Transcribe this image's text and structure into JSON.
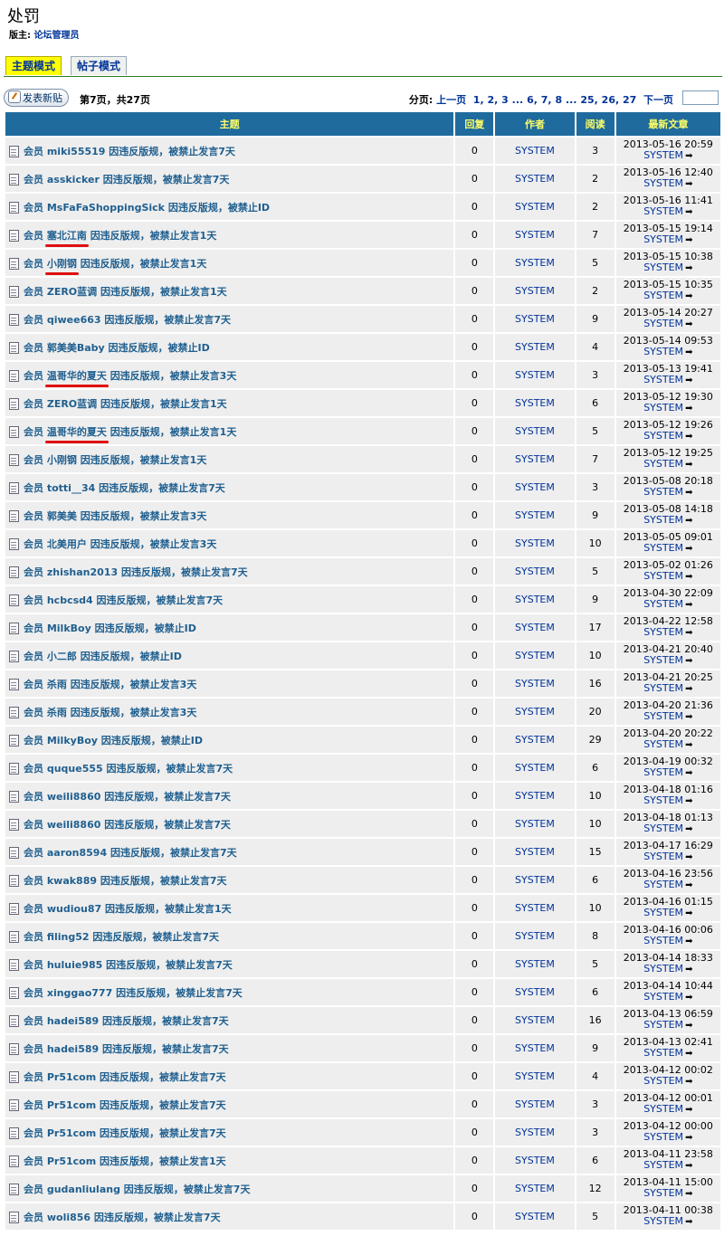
{
  "page": {
    "title": "处罚",
    "moderator_label": "版主:",
    "moderator_name": "论坛管理员"
  },
  "tabs": [
    {
      "label": "主题模式",
      "active": true
    },
    {
      "label": "帖子模式",
      "active": false
    }
  ],
  "toolbar": {
    "new_post_label": "发表新贴",
    "page_info": "第7页，共27页",
    "pager_label": "分页:",
    "prev": "上一页",
    "pages": [
      "1",
      "2",
      "3",
      "...",
      "6",
      "7",
      "8",
      "...",
      "25",
      "26",
      "27"
    ],
    "next": "下一页",
    "jump_value": ""
  },
  "columns": {
    "subject": "主题",
    "replies": "回复",
    "author": "作者",
    "views": "阅读",
    "last_post": "最新文章"
  },
  "colors": {
    "header_bg": "#1f6b9e",
    "header_text": "#ffff66",
    "row_bg": "#eeeeee",
    "link": "#1f5f8f",
    "active_tab": "#ffff00",
    "annotation": "#e01010"
  },
  "rows": [
    {
      "prefix": "会员",
      "member": "miki55519",
      "suffix": "因违反版规，被禁止发言7天",
      "replies": "0",
      "author": "SYSTEM",
      "views": "3",
      "date": "2013-05-16 20:59",
      "last_user": "SYSTEM",
      "marked": false
    },
    {
      "prefix": "会员",
      "member": "asskicker",
      "suffix": "因违反版规，被禁止发言7天",
      "replies": "0",
      "author": "SYSTEM",
      "views": "2",
      "date": "2013-05-16 12:40",
      "last_user": "SYSTEM",
      "marked": false
    },
    {
      "prefix": "会员",
      "member": "MsFaFaShoppingSick",
      "suffix": "因违反版规，被禁止ID",
      "replies": "0",
      "author": "SYSTEM",
      "views": "2",
      "date": "2013-05-16 11:41",
      "last_user": "SYSTEM",
      "marked": false
    },
    {
      "prefix": "会员",
      "member": "塞北江南",
      "suffix": "因违反版规，被禁止发言1天",
      "replies": "0",
      "author": "SYSTEM",
      "views": "7",
      "date": "2013-05-15 19:14",
      "last_user": "SYSTEM",
      "marked": true
    },
    {
      "prefix": "会员",
      "member": "小刚钢",
      "suffix": "因违反版规，被禁止发言1天",
      "replies": "0",
      "author": "SYSTEM",
      "views": "5",
      "date": "2013-05-15 10:38",
      "last_user": "SYSTEM",
      "marked": true
    },
    {
      "prefix": "会员",
      "member": "ZERO蓝调",
      "suffix": "因违反版规，被禁止发言1天",
      "replies": "0",
      "author": "SYSTEM",
      "views": "2",
      "date": "2013-05-15 10:35",
      "last_user": "SYSTEM",
      "marked": false
    },
    {
      "prefix": "会员",
      "member": "qiwee663",
      "suffix": "因违反版规，被禁止发言7天",
      "replies": "0",
      "author": "SYSTEM",
      "views": "9",
      "date": "2013-05-14 20:27",
      "last_user": "SYSTEM",
      "marked": false
    },
    {
      "prefix": "会员",
      "member": "郭美美Baby",
      "suffix": "因违反版规，被禁止ID",
      "replies": "0",
      "author": "SYSTEM",
      "views": "4",
      "date": "2013-05-14 09:53",
      "last_user": "SYSTEM",
      "marked": false
    },
    {
      "prefix": "会员",
      "member": "温哥华的夏天",
      "suffix": "因违反版规，被禁止发言3天",
      "replies": "0",
      "author": "SYSTEM",
      "views": "3",
      "date": "2013-05-13 19:41",
      "last_user": "SYSTEM",
      "marked": true
    },
    {
      "prefix": "会员",
      "member": "ZERO蓝调",
      "suffix": "因违反版规，被禁止发言1天",
      "replies": "0",
      "author": "SYSTEM",
      "views": "6",
      "date": "2013-05-12 19:30",
      "last_user": "SYSTEM",
      "marked": false
    },
    {
      "prefix": "会员",
      "member": "温哥华的夏天",
      "suffix": "因违反版规，被禁止发言1天",
      "replies": "0",
      "author": "SYSTEM",
      "views": "5",
      "date": "2013-05-12 19:26",
      "last_user": "SYSTEM",
      "marked": true
    },
    {
      "prefix": "会员",
      "member": "小刚钢",
      "suffix": "因违反版规，被禁止发言1天",
      "replies": "0",
      "author": "SYSTEM",
      "views": "7",
      "date": "2013-05-12 19:25",
      "last_user": "SYSTEM",
      "marked": false
    },
    {
      "prefix": "会员",
      "member": "totti__34",
      "suffix": "因违反版规，被禁止发言7天",
      "replies": "0",
      "author": "SYSTEM",
      "views": "3",
      "date": "2013-05-08 20:18",
      "last_user": "SYSTEM",
      "marked": false
    },
    {
      "prefix": "会员",
      "member": "郭美美",
      "suffix": "因违反版规，被禁止发言3天",
      "replies": "0",
      "author": "SYSTEM",
      "views": "9",
      "date": "2013-05-08 14:18",
      "last_user": "SYSTEM",
      "marked": false
    },
    {
      "prefix": "会员",
      "member": "北美用户",
      "suffix": "因违反版规，被禁止发言3天",
      "replies": "0",
      "author": "SYSTEM",
      "views": "10",
      "date": "2013-05-05 09:01",
      "last_user": "SYSTEM",
      "marked": false
    },
    {
      "prefix": "会员",
      "member": "zhishan2013",
      "suffix": "因违反版规，被禁止发言7天",
      "replies": "0",
      "author": "SYSTEM",
      "views": "5",
      "date": "2013-05-02 01:26",
      "last_user": "SYSTEM",
      "marked": false
    },
    {
      "prefix": "会员",
      "member": "hcbcsd4",
      "suffix": "因违反版规，被禁止发言7天",
      "replies": "0",
      "author": "SYSTEM",
      "views": "9",
      "date": "2013-04-30 22:09",
      "last_user": "SYSTEM",
      "marked": false
    },
    {
      "prefix": "会员",
      "member": "MilkBoy",
      "suffix": "因违反版规，被禁止ID",
      "replies": "0",
      "author": "SYSTEM",
      "views": "17",
      "date": "2013-04-22 12:58",
      "last_user": "SYSTEM",
      "marked": false
    },
    {
      "prefix": "会员",
      "member": "小二郎",
      "suffix": "因违反版规，被禁止ID",
      "replies": "0",
      "author": "SYSTEM",
      "views": "10",
      "date": "2013-04-21 20:40",
      "last_user": "SYSTEM",
      "marked": false
    },
    {
      "prefix": "会员",
      "member": "杀雨",
      "suffix": "因违反版规，被禁止发言3天",
      "replies": "0",
      "author": "SYSTEM",
      "views": "16",
      "date": "2013-04-21 20:25",
      "last_user": "SYSTEM",
      "marked": false
    },
    {
      "prefix": "会员",
      "member": "杀雨",
      "suffix": "因违反版规，被禁止发言3天",
      "replies": "0",
      "author": "SYSTEM",
      "views": "20",
      "date": "2013-04-20 21:36",
      "last_user": "SYSTEM",
      "marked": false
    },
    {
      "prefix": "会员",
      "member": "MilkyBoy",
      "suffix": "因违反版规，被禁止ID",
      "replies": "0",
      "author": "SYSTEM",
      "views": "29",
      "date": "2013-04-20 20:22",
      "last_user": "SYSTEM",
      "marked": false
    },
    {
      "prefix": "会员",
      "member": "ququе555",
      "suffix": "因违反版规，被禁止发言7天",
      "replies": "0",
      "author": "SYSTEM",
      "views": "6",
      "date": "2013-04-19 00:32",
      "last_user": "SYSTEM",
      "marked": false
    },
    {
      "prefix": "会员",
      "member": "weili8860",
      "suffix": "因违反版规，被禁止发言7天",
      "replies": "0",
      "author": "SYSTEM",
      "views": "10",
      "date": "2013-04-18 01:16",
      "last_user": "SYSTEM",
      "marked": false
    },
    {
      "prefix": "会员",
      "member": "weili8860",
      "suffix": "因违反版规，被禁止发言7天",
      "replies": "0",
      "author": "SYSTEM",
      "views": "10",
      "date": "2013-04-18 01:13",
      "last_user": "SYSTEM",
      "marked": false
    },
    {
      "prefix": "会员",
      "member": "aaron8594",
      "suffix": "因违反版规，被禁止发言7天",
      "replies": "0",
      "author": "SYSTEM",
      "views": "15",
      "date": "2013-04-17 16:29",
      "last_user": "SYSTEM",
      "marked": false
    },
    {
      "prefix": "会员",
      "member": "kwak889",
      "suffix": "因违反版规，被禁止发言7天",
      "replies": "0",
      "author": "SYSTEM",
      "views": "6",
      "date": "2013-04-16 23:56",
      "last_user": "SYSTEM",
      "marked": false
    },
    {
      "prefix": "会员",
      "member": "wudiou87",
      "suffix": "因违反版规，被禁止发言1天",
      "replies": "0",
      "author": "SYSTEM",
      "views": "10",
      "date": "2013-04-16 01:15",
      "last_user": "SYSTEM",
      "marked": false
    },
    {
      "prefix": "会员",
      "member": "filing52",
      "suffix": "因违反版规，被禁止发言7天",
      "replies": "0",
      "author": "SYSTEM",
      "views": "8",
      "date": "2013-04-16 00:06",
      "last_user": "SYSTEM",
      "marked": false
    },
    {
      "prefix": "会员",
      "member": "huluie985",
      "suffix": "因违反版规，被禁止发言7天",
      "replies": "0",
      "author": "SYSTEM",
      "views": "5",
      "date": "2013-04-14 18:33",
      "last_user": "SYSTEM",
      "marked": false
    },
    {
      "prefix": "会员",
      "member": "xinggao777",
      "suffix": "因违反版规，被禁止发言7天",
      "replies": "0",
      "author": "SYSTEM",
      "views": "6",
      "date": "2013-04-14 10:44",
      "last_user": "SYSTEM",
      "marked": false
    },
    {
      "prefix": "会员",
      "member": "hadei589",
      "suffix": "因违反版规，被禁止发言7天",
      "replies": "0",
      "author": "SYSTEM",
      "views": "16",
      "date": "2013-04-13 06:59",
      "last_user": "SYSTEM",
      "marked": false
    },
    {
      "prefix": "会员",
      "member": "hadei589",
      "suffix": "因违反版规，被禁止发言7天",
      "replies": "0",
      "author": "SYSTEM",
      "views": "9",
      "date": "2013-04-13 02:41",
      "last_user": "SYSTEM",
      "marked": false
    },
    {
      "prefix": "会员",
      "member": "Pr51com",
      "suffix": "因违反版规，被禁止发言7天",
      "replies": "0",
      "author": "SYSTEM",
      "views": "4",
      "date": "2013-04-12 00:02",
      "last_user": "SYSTEM",
      "marked": false
    },
    {
      "prefix": "会员",
      "member": "Pr51com",
      "suffix": "因违反版规，被禁止发言7天",
      "replies": "0",
      "author": "SYSTEM",
      "views": "3",
      "date": "2013-04-12 00:01",
      "last_user": "SYSTEM",
      "marked": false
    },
    {
      "prefix": "会员",
      "member": "Pr51com",
      "suffix": "因违反版规，被禁止发言7天",
      "replies": "0",
      "author": "SYSTEM",
      "views": "3",
      "date": "2013-04-12 00:00",
      "last_user": "SYSTEM",
      "marked": false
    },
    {
      "prefix": "会员",
      "member": "Pr51com",
      "suffix": "因违反版规，被禁止发言1天",
      "replies": "0",
      "author": "SYSTEM",
      "views": "6",
      "date": "2013-04-11 23:58",
      "last_user": "SYSTEM",
      "marked": false
    },
    {
      "prefix": "会员",
      "member": "gudanliulang",
      "suffix": "因违反版规，被禁止发言7天",
      "replies": "0",
      "author": "SYSTEM",
      "views": "12",
      "date": "2013-04-11 15:00",
      "last_user": "SYSTEM",
      "marked": false
    },
    {
      "prefix": "会员",
      "member": "woli856",
      "suffix": "因违反版规，被禁止发言7天",
      "replies": "0",
      "author": "SYSTEM",
      "views": "5",
      "date": "2013-04-11 00:38",
      "last_user": "SYSTEM",
      "marked": false
    }
  ]
}
